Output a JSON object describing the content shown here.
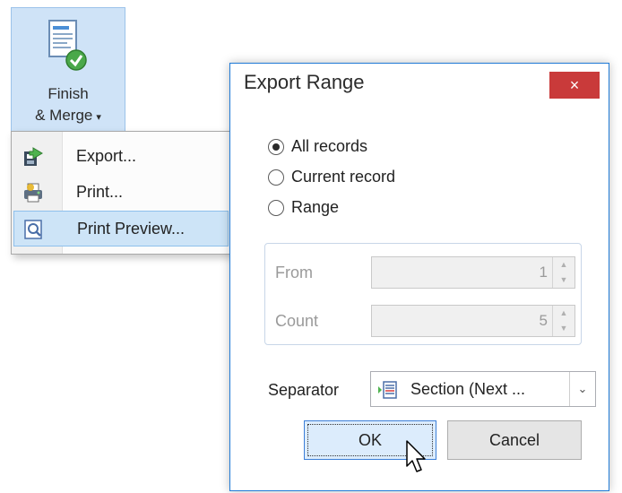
{
  "ribbon": {
    "button_line1": "Finish",
    "button_line2": "& Merge",
    "button_icon": "document-check-icon"
  },
  "menu": {
    "items": [
      {
        "label": "Export...",
        "icon": "export-icon"
      },
      {
        "label": "Print...",
        "icon": "printer-icon"
      },
      {
        "label": "Print Preview...",
        "icon": "print-preview-icon"
      }
    ],
    "hover_color": "#cde4f7"
  },
  "dialog": {
    "title": "Export Range",
    "close_label": "×",
    "radios": [
      {
        "label": "All records",
        "checked": true
      },
      {
        "label": "Current record",
        "checked": false
      },
      {
        "label": "Range",
        "checked": false
      }
    ],
    "from_label": "From",
    "from_value": "1",
    "count_label": "Count",
    "count_value": "5",
    "separator_label": "Separator",
    "separator_value": "Section (Next ...",
    "separator_icon": "section-break-icon",
    "ok_label": "OK",
    "cancel_label": "Cancel"
  },
  "colors": {
    "dialog_border": "#1f7ad6",
    "close_bg": "#c93a3a",
    "ribbon_bg": "#cfe3f7"
  }
}
